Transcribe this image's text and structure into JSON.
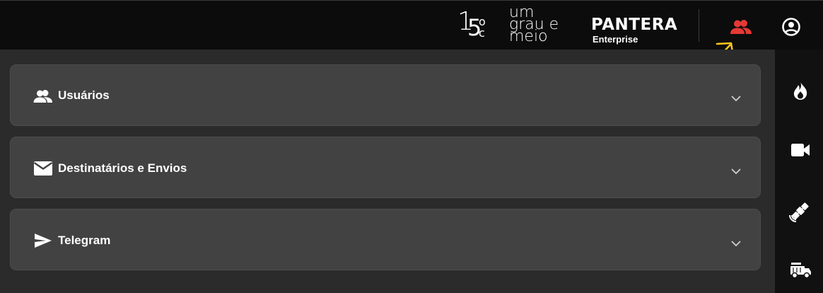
{
  "header": {
    "logo_15": {
      "one": "1",
      "five": "5",
      "degree": "o",
      "unit": "c"
    },
    "logo_umgrau": [
      "um",
      "grau e",
      "meio"
    ],
    "brand": {
      "name": "PANTERA",
      "subtitle": "Enterprise"
    },
    "icons": [
      "users-icon",
      "account-circle-icon"
    ],
    "active_color": "#e53935"
  },
  "annotation": {
    "color": "#f7c31d",
    "icon": "arrow-icon"
  },
  "sections": [
    {
      "icon": "users-icon",
      "label": "Usuários"
    },
    {
      "icon": "mail-icon",
      "label": "Destinatários e Envios"
    },
    {
      "icon": "send-icon",
      "label": "Telegram"
    }
  ],
  "right_rail": {
    "icons": [
      "fire-icon",
      "videocam-icon",
      "satellite-icon",
      "fire-truck-icon"
    ]
  },
  "colors": {
    "topbar": "#0c0c0c",
    "background": "#2b2b2b",
    "panel": "#424242",
    "rail": "#111111"
  }
}
